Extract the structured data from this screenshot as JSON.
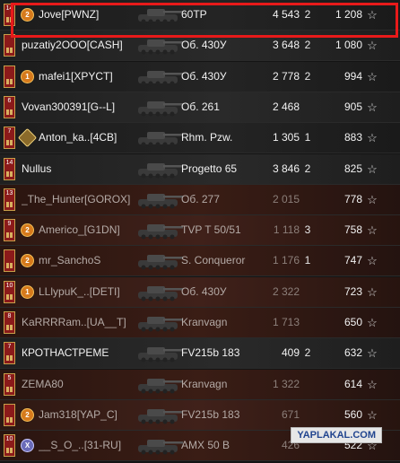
{
  "watermark": "YAPLAKAL.COM",
  "players": [
    {
      "rank": "14",
      "badge": "2",
      "badge_style": "orange",
      "name": "Jove[PWNZ]",
      "vehicle": "60TP",
      "damage": "4 543",
      "kills": "2",
      "xp": "1 208",
      "alive": true,
      "highlighted": true
    },
    {
      "rank": "",
      "badge": "",
      "badge_style": "",
      "name": "puzatiy2OOO[CASH]",
      "vehicle": "Об. 430У",
      "damage": "3 648",
      "kills": "2",
      "xp": "1 080",
      "alive": true,
      "highlighted": false
    },
    {
      "rank": "",
      "badge": "1",
      "badge_style": "orange",
      "name": "mafei1[XPYCT]",
      "vehicle": "Об. 430У",
      "damage": "2 778",
      "kills": "2",
      "xp": "994",
      "alive": true,
      "highlighted": false
    },
    {
      "rank": "6",
      "badge": "",
      "badge_style": "",
      "name": "Vovan300391[G--L]",
      "vehicle": "Об. 261",
      "damage": "2 468",
      "kills": "",
      "xp": "905",
      "alive": true,
      "highlighted": false
    },
    {
      "rank": "7",
      "badge": "",
      "badge_style": "gold",
      "name": "Anton_ka..[4CB]",
      "vehicle": "Rhm. Pzw.",
      "damage": "1 305",
      "kills": "1",
      "xp": "883",
      "alive": true,
      "highlighted": false
    },
    {
      "rank": "14",
      "badge": "",
      "badge_style": "",
      "name": "Nullus",
      "vehicle": "Progetto 65",
      "damage": "3 846",
      "kills": "2",
      "xp": "825",
      "alive": true,
      "highlighted": false
    },
    {
      "rank": "13",
      "badge": "",
      "badge_style": "",
      "name": "_The_Hunter[GOROX]",
      "vehicle": "Об. 277",
      "damage": "2 015",
      "kills": "",
      "xp": "778",
      "alive": false,
      "highlighted": false
    },
    {
      "rank": "9",
      "badge": "2",
      "badge_style": "orange",
      "name": "Americo_[G1DN]",
      "vehicle": "TVP T 50/51",
      "damage": "1 118",
      "kills": "3",
      "xp": "758",
      "alive": false,
      "highlighted": false
    },
    {
      "rank": "",
      "badge": "2",
      "badge_style": "orange",
      "name": "mr_SanchoS",
      "vehicle": "S. Conqueror",
      "damage": "1 176",
      "kills": "1",
      "xp": "747",
      "alive": false,
      "highlighted": false
    },
    {
      "rank": "10",
      "badge": "1",
      "badge_style": "orange",
      "name": "LLlypuK_..[DETI]",
      "vehicle": "Об. 430У",
      "damage": "2 322",
      "kills": "",
      "xp": "723",
      "alive": false,
      "highlighted": false
    },
    {
      "rank": "8",
      "badge": "",
      "badge_style": "",
      "name": "KaRRRRam..[UA__T]",
      "vehicle": "Kranvagn",
      "damage": "1 713",
      "kills": "",
      "xp": "650",
      "alive": false,
      "highlighted": false
    },
    {
      "rank": "7",
      "badge": "",
      "badge_style": "",
      "name": "КРОТНАСТРЕМЕ",
      "vehicle": "FV215b 183",
      "damage": "409",
      "kills": "2",
      "xp": "632",
      "alive": true,
      "highlighted": false
    },
    {
      "rank": "5",
      "badge": "",
      "badge_style": "",
      "name": "ZEMA80",
      "vehicle": "Kranvagn",
      "damage": "1 322",
      "kills": "",
      "xp": "614",
      "alive": false,
      "highlighted": false
    },
    {
      "rank": "",
      "badge": "2",
      "badge_style": "orange",
      "name": "Jam318[YAP_C]",
      "vehicle": "FV215b 183",
      "damage": "671",
      "kills": "",
      "xp": "560",
      "alive": false,
      "highlighted": false
    },
    {
      "rank": "10",
      "badge": "X",
      "badge_style": "purple",
      "name": "__S_O_..[31-RU]",
      "vehicle": "AMX 50 B",
      "damage": "426",
      "kills": "",
      "xp": "522",
      "alive": false,
      "highlighted": false
    }
  ]
}
